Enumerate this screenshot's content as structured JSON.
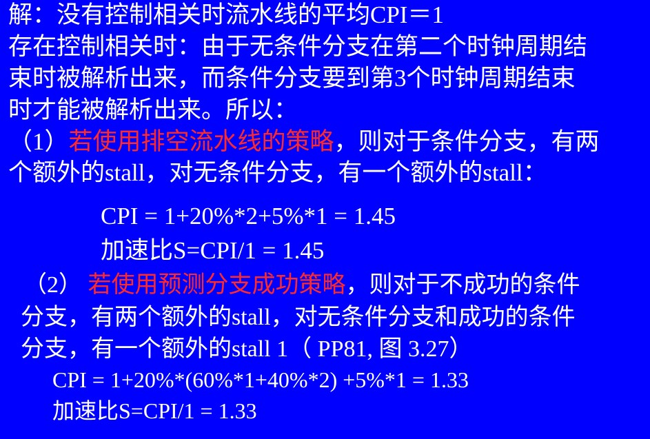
{
  "slide": {
    "line1": "解：没有控制相关时流水线的平均CPI＝1",
    "line2": "存在控制相关时：由于无条件分支在第二个时钟周期结",
    "line3": "束时被解析出来，而条件分支要到第3个时钟周期结束",
    "line4": "时才能被解析出来。所以：",
    "case1": {
      "prefix": "（1）",
      "highlight": "若使用排空流水线的策略",
      "suffix": "，则对于条件分支，有两",
      "line2": "个额外的stall，对无条件分支，有一个额外的stall："
    },
    "formula1": "CPI = 1+20%*2+5%*1 = 1.45",
    "speedup1": "加速比S=CPI/1 = 1.45",
    "case2": {
      "prefix": "（2） ",
      "highlight": "若使用预测分支成功策略",
      "suffix": "，则对于不成功的条件",
      "line2": "分支，有两个额外的stall，对无条件分支和成功的条件",
      "line3": "分支，有一个额外的stall 1（ PP81, 图 3.27）"
    },
    "formula2": "CPI = 1+20%*(60%*1+40%*2) +5%*1 = 1.33",
    "speedup2": "加速比S=CPI/1 = 1.33"
  },
  "colors": {
    "background": "#0000ff",
    "text": "#ffffff",
    "highlight": "#ff2a2a"
  }
}
